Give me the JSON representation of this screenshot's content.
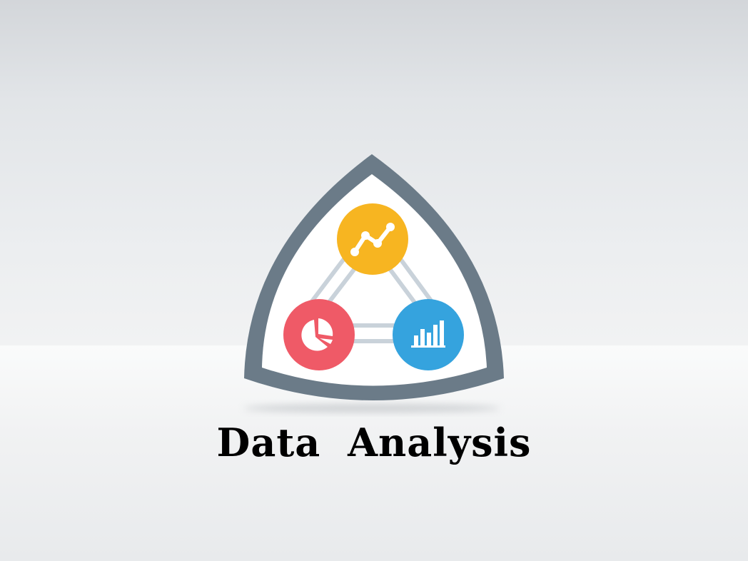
{
  "title": "Data Analysis",
  "logo": {
    "nodes": [
      {
        "name": "line-chart-node",
        "icon": "line-chart-icon",
        "color": "#f7b521"
      },
      {
        "name": "pie-chart-node",
        "icon": "pie-chart-icon",
        "color": "#ef5a67"
      },
      {
        "name": "bar-chart-node",
        "icon": "bar-chart-icon",
        "color": "#35a3de"
      }
    ],
    "shield_outline_color": "#6b7b88",
    "shield_fill_color": "#ffffff",
    "connector_color": "#c9d2da"
  }
}
